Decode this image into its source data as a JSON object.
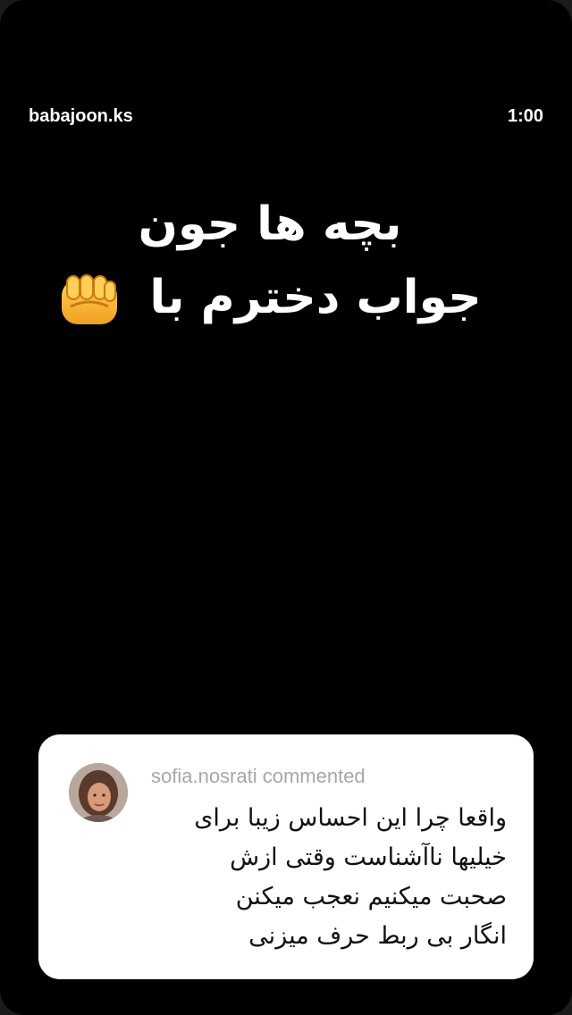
{
  "story": {
    "username": "babajoon.ks",
    "duration": "1:00",
    "headline_lines": [
      "بچه ها جون",
      "جواب دخترم با"
    ],
    "emoji": "fist-emoji"
  },
  "comment": {
    "author_line": "sofia.nosrati commented",
    "text_lines": [
      "واقعا چرا این احساس زیبا برای",
      "خیلیها ناآشناست وقتی ازش",
      "صحبت میکنیم نعجب میکنن",
      "انگار بی ربط حرف میزنی"
    ]
  },
  "colors": {
    "background": "#000000",
    "text": "#ffffff",
    "card": "#ffffff",
    "muted": "#a7a7a7"
  }
}
